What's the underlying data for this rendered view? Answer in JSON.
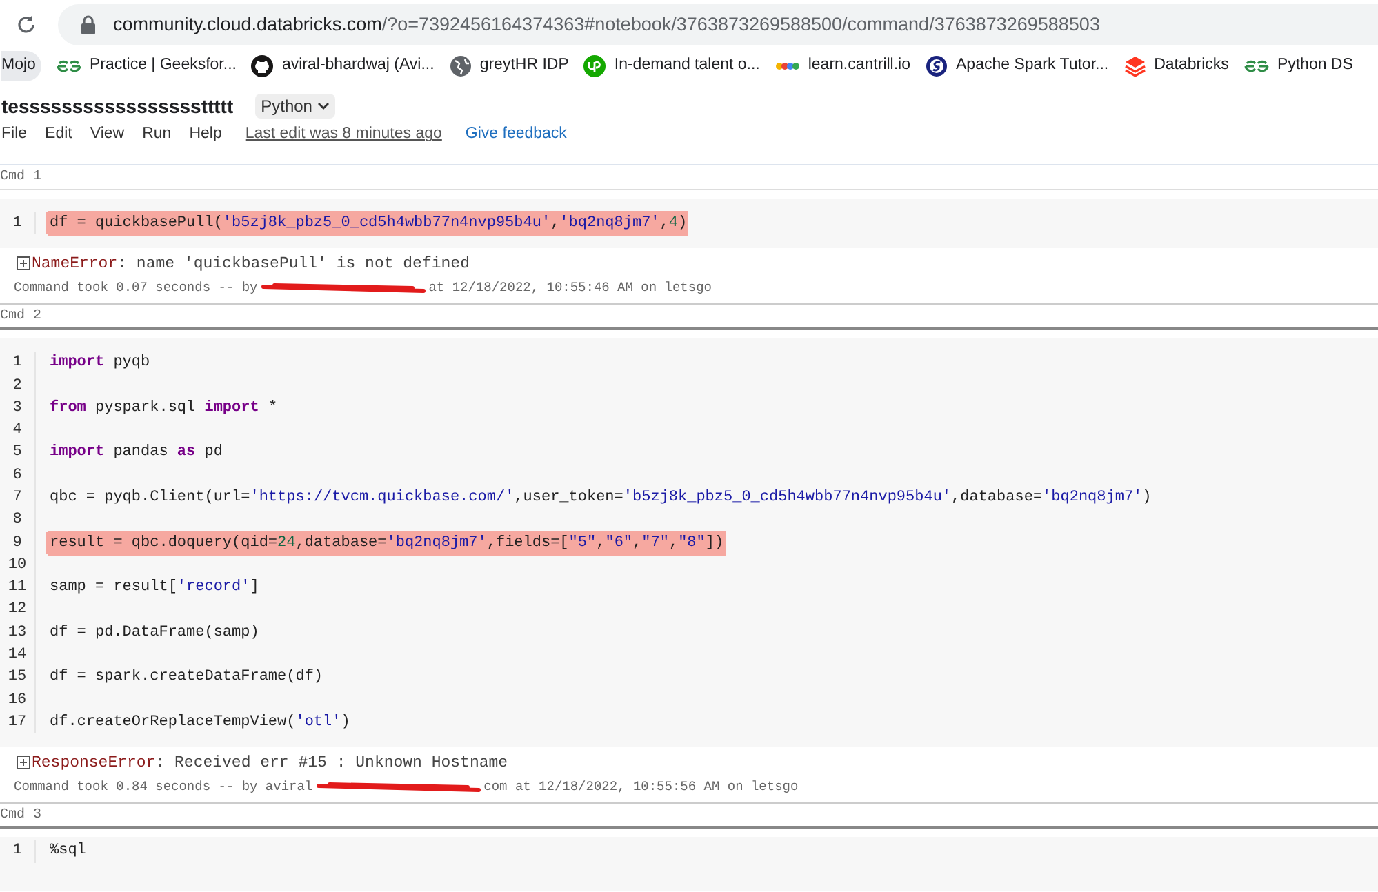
{
  "browser": {
    "url_host": "community.cloud.databricks.com",
    "url_rest": "/?o=7392456164374363#notebook/3763873269588500/command/3763873269588503",
    "bookmarks": [
      {
        "label": "Mojo",
        "kind": "pill"
      },
      {
        "label": "Practice | Geeksfor...",
        "kind": "gfg"
      },
      {
        "label": "aviral-bhardwaj (Avi...",
        "kind": "github"
      },
      {
        "label": "greytHR IDP",
        "kind": "globe"
      },
      {
        "label": "In-demand talent o...",
        "kind": "upwork"
      },
      {
        "label": "learn.cantrill.io",
        "kind": "dots"
      },
      {
        "label": "Apache Spark Tutor...",
        "kind": "spark"
      },
      {
        "label": "Databricks",
        "kind": "databricks"
      },
      {
        "label": "Python DS",
        "kind": "gfg"
      }
    ]
  },
  "notebook": {
    "title": "tesssssssssssssssssttttt",
    "language": "Python",
    "menu": [
      "File",
      "Edit",
      "View",
      "Run",
      "Help"
    ],
    "last_edit": "Last edit was 8 minutes ago",
    "feedback": "Give feedback"
  },
  "commands": [
    {
      "label": "Cmd 1",
      "lines": [
        {
          "number": "1",
          "highlighted": true,
          "tokens": [
            {
              "kind": "plain",
              "text": "df = quickbasePull("
            },
            {
              "kind": "str",
              "text": "'b5zj8k_pbz5_0_cd5h4wbb77n4nvp95b4u'"
            },
            {
              "kind": "plain",
              "text": ","
            },
            {
              "kind": "str",
              "text": "'bq2nq8jm7'"
            },
            {
              "kind": "plain",
              "text": ","
            },
            {
              "kind": "num",
              "text": "4"
            },
            {
              "kind": "plain",
              "text": ")"
            }
          ]
        }
      ],
      "error_type": "NameError",
      "error_message": ": name 'quickbasePull' is not defined",
      "meta_before": "Command took 0.07 seconds -- by",
      "meta_after": "at 12/18/2022, 10:55:46 AM on letsgo"
    },
    {
      "label": "Cmd 2",
      "lines": [
        {
          "number": "1",
          "highlighted": false,
          "tokens": [
            {
              "kind": "kw",
              "text": "import"
            },
            {
              "kind": "plain",
              "text": " pyqb"
            }
          ]
        },
        {
          "number": "2",
          "highlighted": false
        },
        {
          "number": "3",
          "highlighted": false,
          "tokens": [
            {
              "kind": "kw",
              "text": "from"
            },
            {
              "kind": "plain",
              "text": " pyspark.sql "
            },
            {
              "kind": "kw",
              "text": "import"
            },
            {
              "kind": "plain",
              "text": " *"
            }
          ]
        },
        {
          "number": "4",
          "highlighted": false
        },
        {
          "number": "5",
          "highlighted": false,
          "tokens": [
            {
              "kind": "kw",
              "text": "import"
            },
            {
              "kind": "plain",
              "text": " pandas "
            },
            {
              "kind": "kw",
              "text": "as"
            },
            {
              "kind": "plain",
              "text": " pd"
            }
          ]
        },
        {
          "number": "6",
          "highlighted": false
        },
        {
          "number": "7",
          "highlighted": false,
          "tokens": [
            {
              "kind": "plain",
              "text": "qbc = pyqb.Client(url="
            },
            {
              "kind": "str",
              "text": "'https://tvcm.quickbase.com/'"
            },
            {
              "kind": "plain",
              "text": ",user_token="
            },
            {
              "kind": "str",
              "text": "'b5zj8k_pbz5_0_cd5h4wbb77n4nvp95b4u'"
            },
            {
              "kind": "plain",
              "text": ",database="
            },
            {
              "kind": "str",
              "text": "'bq2nq8jm7'"
            },
            {
              "kind": "plain",
              "text": ")"
            }
          ]
        },
        {
          "number": "8",
          "highlighted": false
        },
        {
          "number": "9",
          "highlighted": true,
          "tokens": [
            {
              "kind": "plain",
              "text": "result = qbc.doquery(qid="
            },
            {
              "kind": "num",
              "text": "24"
            },
            {
              "kind": "plain",
              "text": ",database="
            },
            {
              "kind": "str",
              "text": "'bq2nq8jm7'"
            },
            {
              "kind": "plain",
              "text": ",fields=["
            },
            {
              "kind": "str",
              "text": "\"5\""
            },
            {
              "kind": "plain",
              "text": ","
            },
            {
              "kind": "str",
              "text": "\"6\""
            },
            {
              "kind": "plain",
              "text": ","
            },
            {
              "kind": "str",
              "text": "\"7\""
            },
            {
              "kind": "plain",
              "text": ","
            },
            {
              "kind": "str",
              "text": "\"8\""
            },
            {
              "kind": "plain",
              "text": "])"
            }
          ]
        },
        {
          "number": "10",
          "highlighted": false
        },
        {
          "number": "11",
          "highlighted": false,
          "tokens": [
            {
              "kind": "plain",
              "text": "samp = result["
            },
            {
              "kind": "str",
              "text": "'record'"
            },
            {
              "kind": "plain",
              "text": "]"
            }
          ]
        },
        {
          "number": "12",
          "highlighted": false
        },
        {
          "number": "13",
          "highlighted": false,
          "tokens": [
            {
              "kind": "plain",
              "text": "df = pd.DataFrame(samp)"
            }
          ]
        },
        {
          "number": "14",
          "highlighted": false
        },
        {
          "number": "15",
          "highlighted": false,
          "tokens": [
            {
              "kind": "plain",
              "text": "df = spark.createDataFrame(df)"
            }
          ]
        },
        {
          "number": "16",
          "highlighted": false
        },
        {
          "number": "17",
          "highlighted": false,
          "tokens": [
            {
              "kind": "plain",
              "text": "df.createOrReplaceTempView("
            },
            {
              "kind": "str",
              "text": "'otl'"
            },
            {
              "kind": "plain",
              "text": ")"
            }
          ]
        }
      ],
      "error_type": "ResponseError",
      "error_message": ": Received err #15 : Unknown Hostname",
      "meta_before": "Command took 0.84 seconds -- by aviral",
      "meta_after": "com at 12/18/2022, 10:55:56 AM on letsgo"
    },
    {
      "label": "Cmd 3",
      "lines": [
        {
          "number": "1",
          "highlighted": false,
          "tokens": [
            {
              "kind": "plain",
              "text": "%sql"
            }
          ]
        }
      ]
    }
  ]
}
